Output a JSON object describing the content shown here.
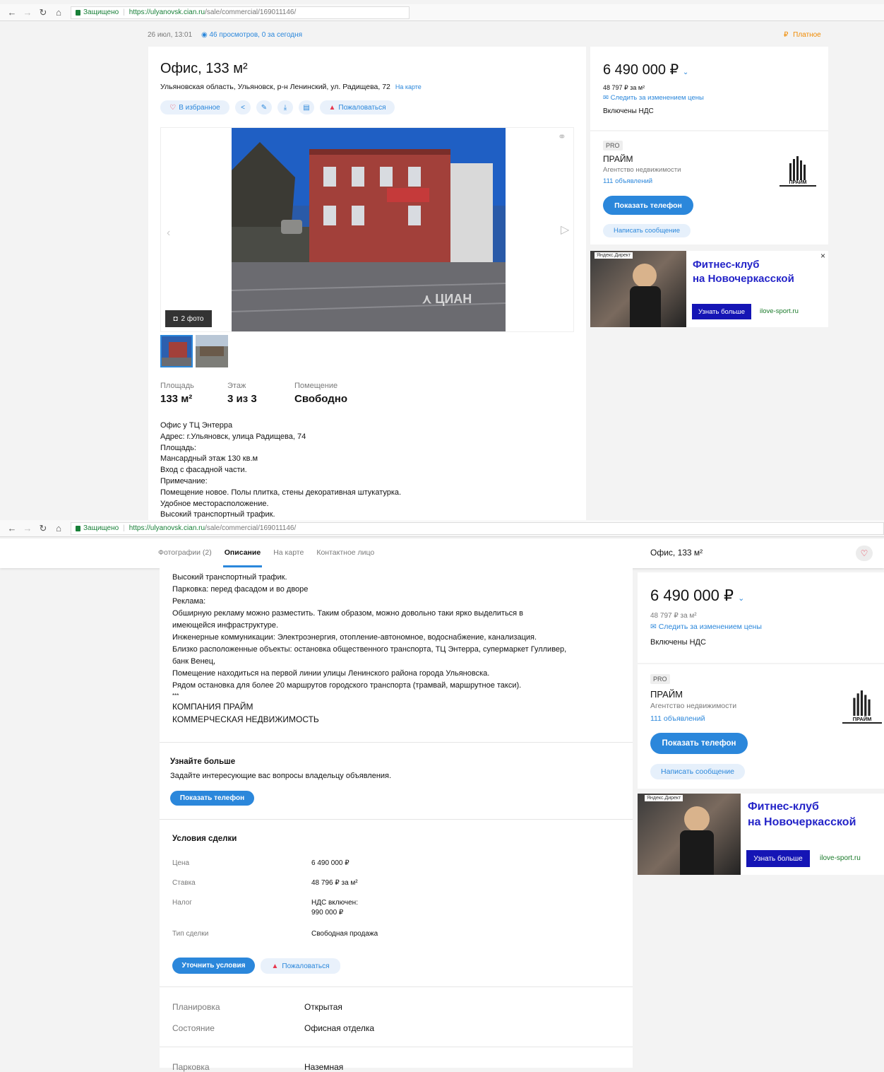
{
  "browser": {
    "secure_label": "Защищено",
    "url_host": "https://ulyanovsk.cian.ru",
    "url_path": "/sale/commercial/169011146/"
  },
  "meta": {
    "date": "26 июл, 13:01",
    "views": "46 просмотров, 0 за сегодня",
    "paid": "Платное"
  },
  "listing": {
    "title": "Офис, 133 м²",
    "address": "Ульяновская область, Ульяновск, р-н Ленинский, ул. Радищева, 72",
    "map_link": "На карте",
    "favorite": "В избранное",
    "complain": "Пожаловаться",
    "photo_count": "2 фото",
    "watermark": "ЦИАН",
    "facts": [
      {
        "label": "Площадь",
        "value": "133 м²"
      },
      {
        "label": "Этаж",
        "value": "3 из 3"
      },
      {
        "label": "Помещение",
        "value": "Свободно"
      }
    ],
    "description_top": [
      "Офис у ТЦ Энтерра",
      "Адрес: г.Ульяновск, улица Радищева, 74",
      "Площадь:",
      "Мансардный этаж 130 кв.м",
      "Вход с фасадной части.",
      "Примечание:",
      "Помещение новое. Полы плитка, стены декоративная штукатурка.",
      "Удобное месторасположение.",
      "Высокий транспортный трафик."
    ]
  },
  "price_card": {
    "price": "6 490 000 ₽",
    "per_m2": "48 797 ₽ за м²",
    "follow": "Следить за изменением цены",
    "vat": "Включены НДС",
    "pro": "PRO",
    "agency": "ПРАЙМ",
    "agency_type": "Агентство недвижимости",
    "ads_count": "111 объявлений",
    "show_phone": "Показать телефон",
    "write": "Написать сообщение",
    "logo_text": "ПРАЙМ"
  },
  "ad": {
    "tag": "Яндекс.Директ",
    "title_line1": "Фитнес-клуб",
    "title_line2": "на Новочеркасской",
    "button": "Узнать больше",
    "domain": "ilove-sport.ru",
    "close": "×"
  },
  "tabs": {
    "photos": "Фотографии (2)",
    "description": "Описание",
    "map": "На карте",
    "contact": "Контактное лицо",
    "sticky_title": "Офис, 133 м²"
  },
  "description_bottom": [
    "Высокий транспортный трафик.",
    "Парковка: перед фасадом и во дворе",
    "Реклама:",
    "Обширную рекламу можно разместить. Таким образом, можно довольно таки ярко выделиться в",
    "имеющейся инфраструктуре.",
    "Инженерные коммуникации: Электроэнергия, отопление-автономное, водоснабжение, канализация.",
    "Близко расположенные объекты: остановка общественного транспорта, ТЦ Энтерра, супермаркет Гулливер,",
    "банк Венец,",
    "Помещение находиться на первой линии улицы Ленинского района города Ульяновска.",
    "Рядом остановка для более 20 маршрутов городского транспорта (трамвай, маршрутное такси).",
    "***",
    "КОМПАНИЯ ПРАЙМ",
    "КОММЕРЧЕСКАЯ НЕДВИЖИМОСТЬ"
  ],
  "learn_more": {
    "title": "Узнайте больше",
    "text": "Задайте интересующие вас вопросы владельцу объявления.",
    "button": "Показать телефон"
  },
  "deal": {
    "title": "Условия сделки",
    "rows": [
      {
        "label": "Цена",
        "value": "6 490 000 ₽",
        "value2": ""
      },
      {
        "label": "Ставка",
        "value": "48 796 ₽ за м²",
        "value2": ""
      },
      {
        "label": "Налог",
        "value": "НДС включен:",
        "value2": "990 000 ₽"
      },
      {
        "label": "Тип сделки",
        "value": "Свободная продажа",
        "value2": ""
      }
    ],
    "clarify": "Уточнить условия",
    "complain": "Пожаловаться"
  },
  "details": [
    {
      "label": "Планировка",
      "value": "Открытая"
    },
    {
      "label": "Состояние",
      "value": "Офисная отделка"
    },
    {
      "label": "Парковка",
      "value": "Наземная"
    }
  ]
}
